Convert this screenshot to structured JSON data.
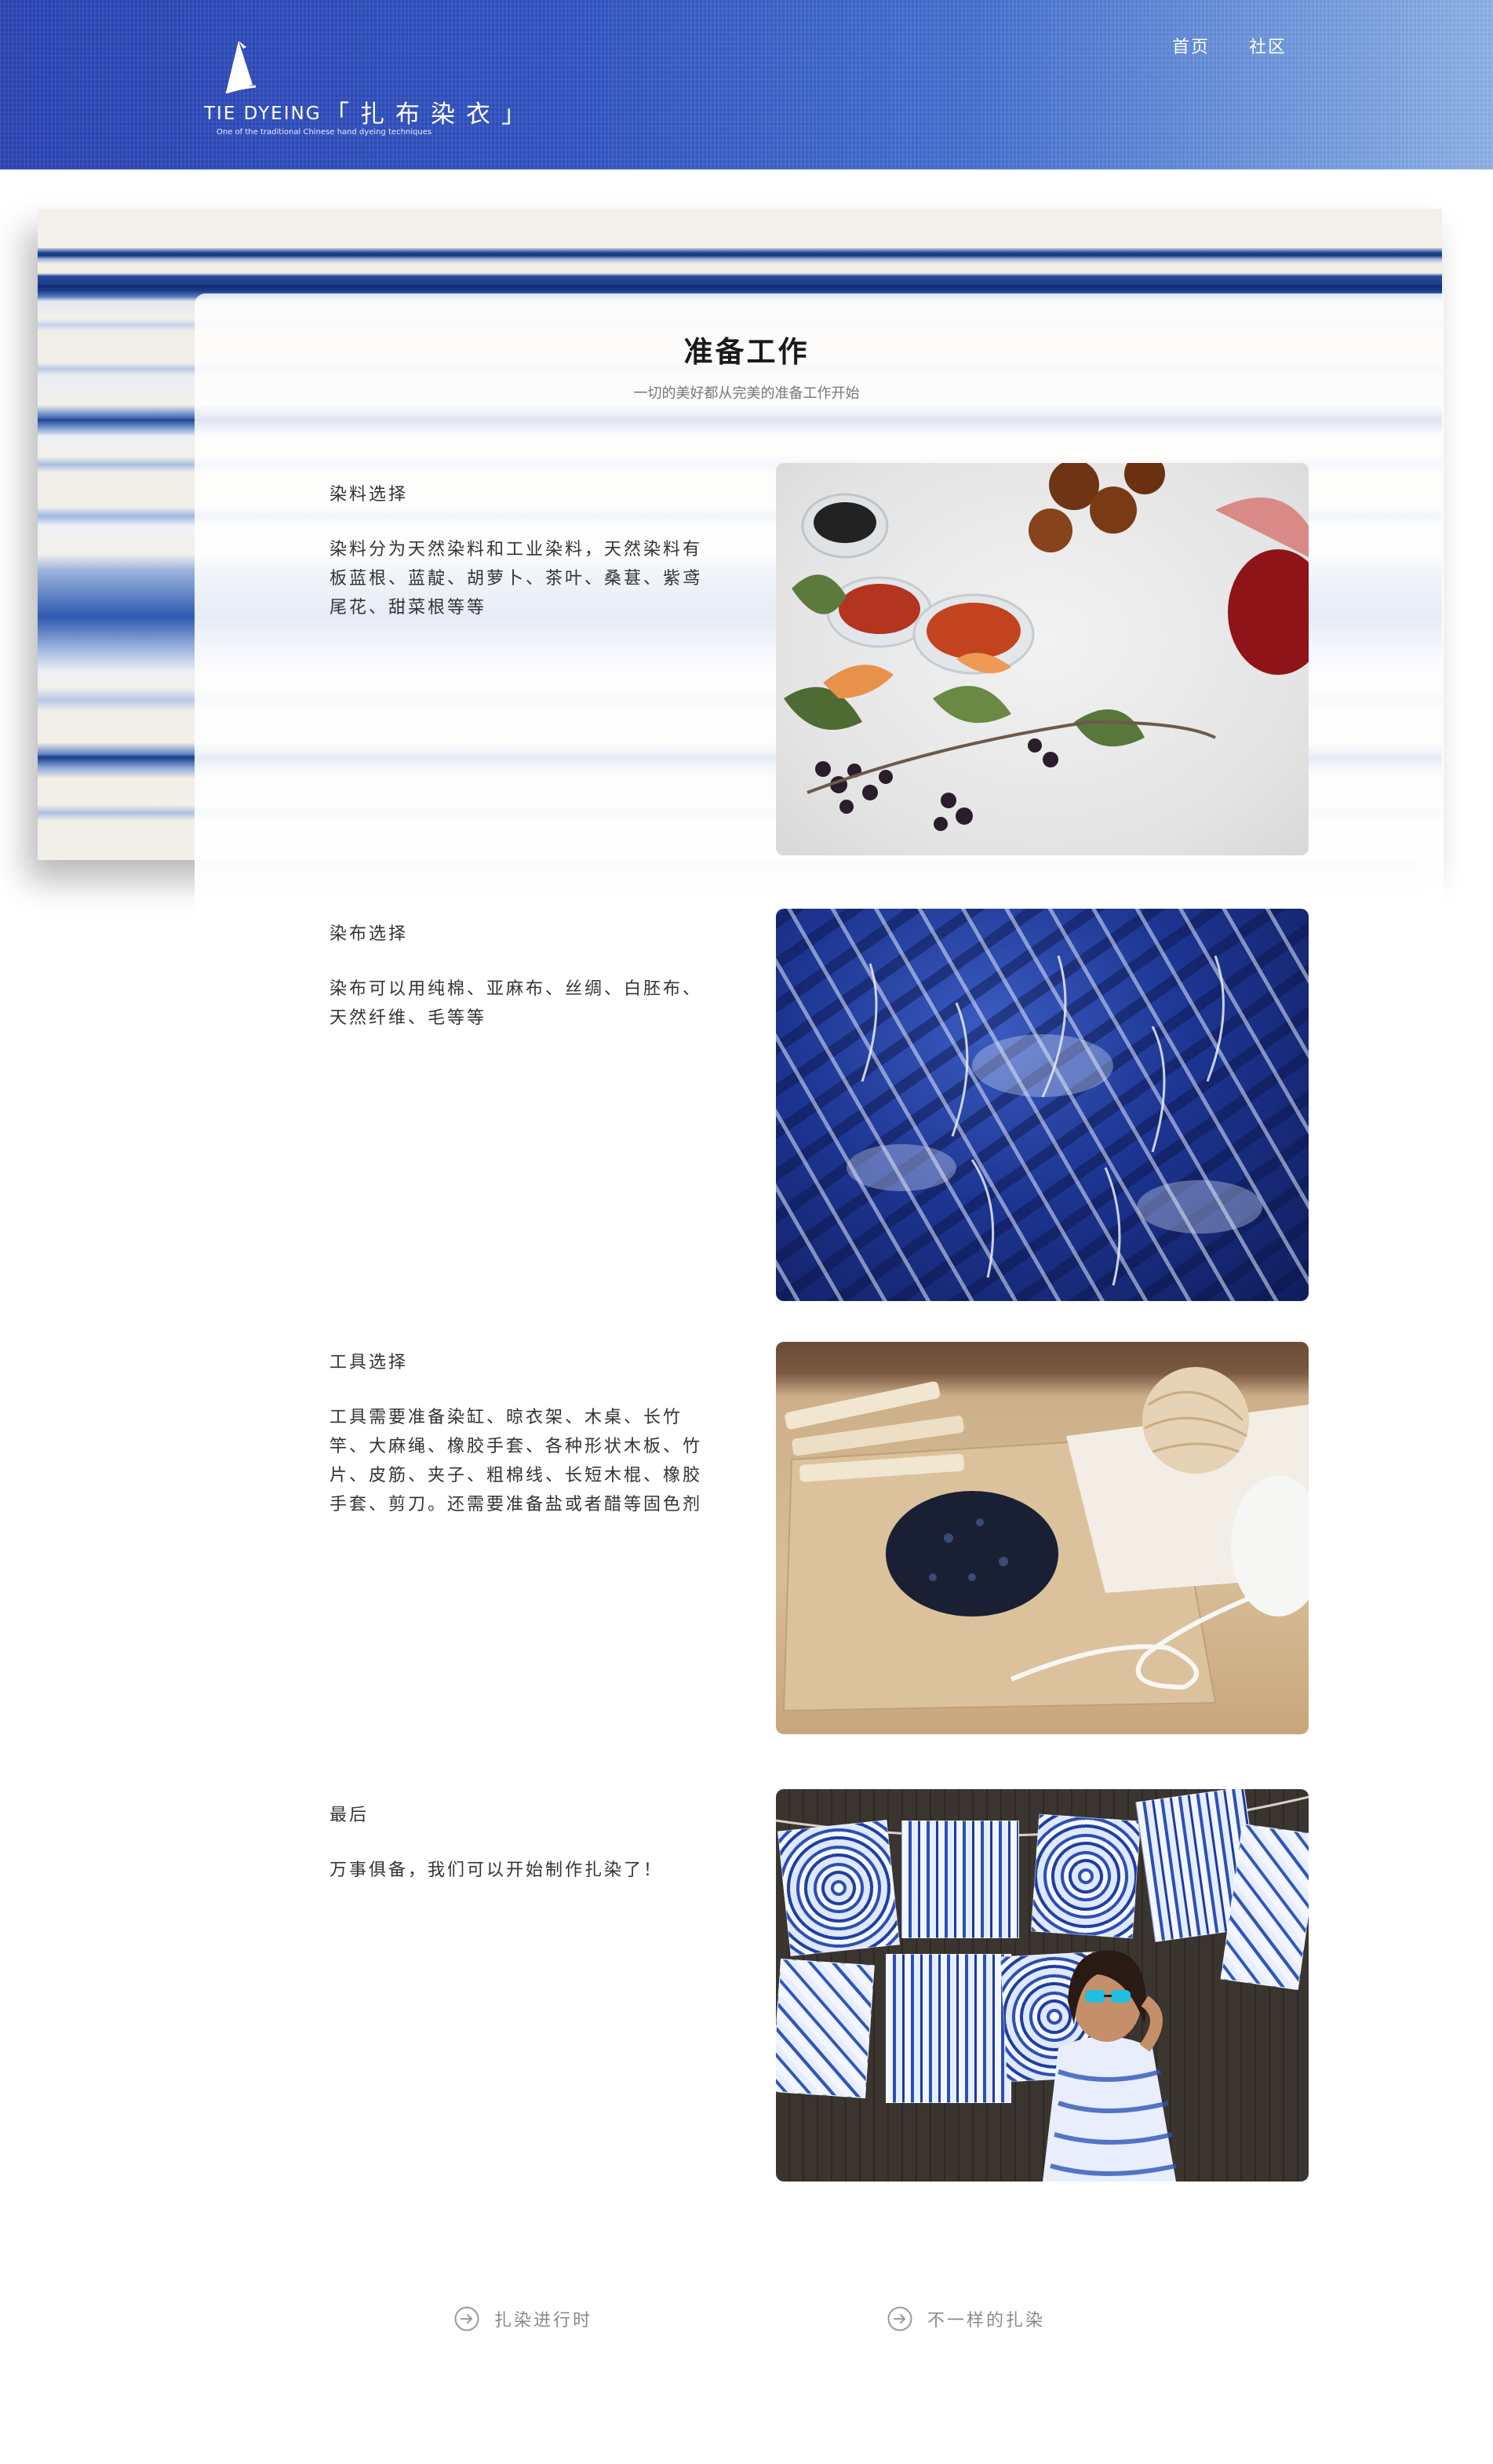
{
  "header": {
    "logo_en": "TIE DYEING",
    "logo_cn": "「扎布染衣」",
    "logo_tagline": "One of the traditional Chinese hand dyeing techniques",
    "nav": {
      "home": "首页",
      "community": "社区"
    }
  },
  "page": {
    "title": "准备工作",
    "subtitle": "一切的美好都从完美的准备工作开始"
  },
  "sections": [
    {
      "heading": "染料选择",
      "text": "染料分为天然染料和工业染料，天然染料有板蓝根、蓝靛、胡萝卜、茶叶、桑葚、紫鸢尾花、甜菜根等等"
    },
    {
      "heading": "染布选择",
      "text": "染布可以用纯棉、亚麻布、丝绸、白胚布、天然纤维、毛等等"
    },
    {
      "heading": "工具选择",
      "text": "工具需要准备染缸、晾衣架、木桌、长竹竿、大麻绳、橡胶手套、各种形状木板、竹片、皮筋、夹子、粗棉线、长短木棍、橡胶手套、剪刀。还需要准备盐或者醋等固色剂"
    },
    {
      "heading": "最后",
      "text": "万事俱备，我们可以开始制作扎染了！"
    }
  ],
  "footer": {
    "link_1": "扎染进行时",
    "link_2": "不一样的扎染"
  },
  "colors": {
    "header_blue": "#3153c4",
    "indigo": "#1f418c",
    "text": "#333333",
    "muted": "#8a8a8a"
  }
}
